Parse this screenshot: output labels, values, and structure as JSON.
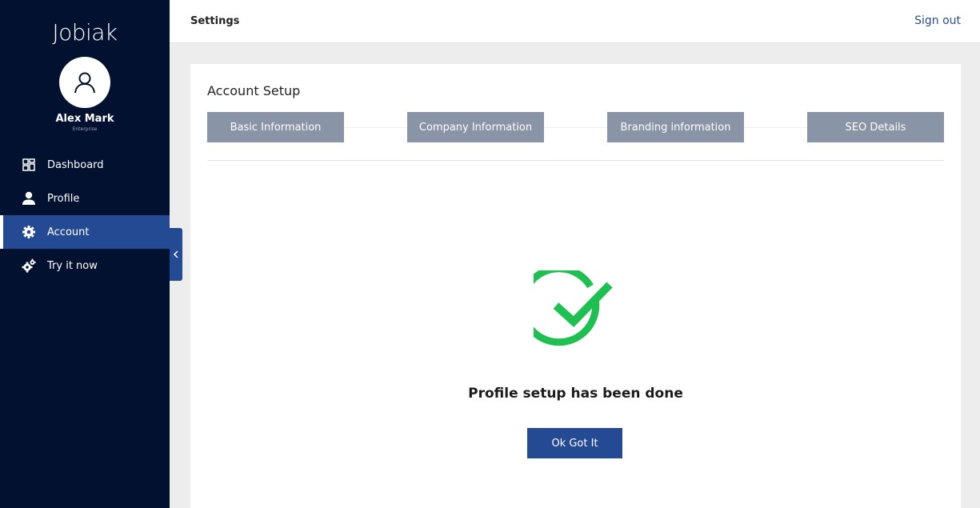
{
  "brand": {
    "logo_text": "Jobiak"
  },
  "user": {
    "name": "Alex Mark",
    "plan": "Enterprise"
  },
  "nav": {
    "items": [
      {
        "label": "Dashboard",
        "icon": "dashboard-grid-icon",
        "active": false
      },
      {
        "label": "Profile",
        "icon": "person-icon",
        "active": false
      },
      {
        "label": "Account",
        "icon": "gear-icon",
        "active": true
      },
      {
        "label": "Try it now",
        "icon": "gears-icon",
        "active": false
      }
    ]
  },
  "header": {
    "title": "Settings",
    "signout_label": "Sign out"
  },
  "card": {
    "title": "Account Setup",
    "steps": [
      "Basic Information",
      "Company Information",
      "Branding information",
      "SEO Details"
    ],
    "success_message": "Profile setup has been done",
    "ok_button_label": "Ok Got It"
  },
  "colors": {
    "sidebar_bg": "#02112f",
    "accent": "#234a93",
    "step_bg": "#8a94a7",
    "success_green": "#1dc051"
  }
}
